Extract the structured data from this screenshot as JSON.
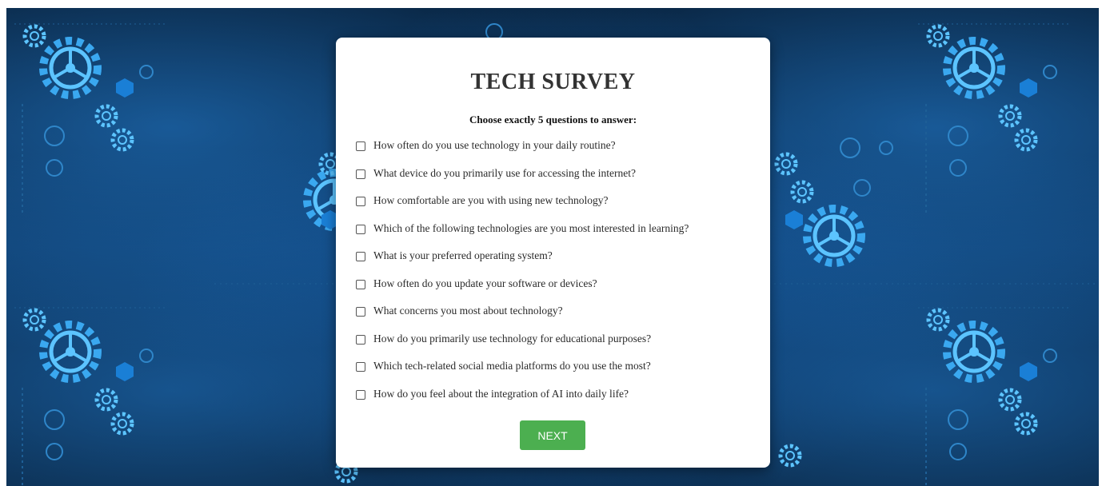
{
  "survey": {
    "title": "TECH SURVEY",
    "instruction": "Choose exactly 5 questions to answer:",
    "questions": [
      "How often do you use technology in your daily routine?",
      "What device do you primarily use for accessing the internet?",
      "How comfortable are you with using new technology?",
      "Which of the following technologies are you most interested in learning?",
      "What is your preferred operating system?",
      "How often do you update your software or devices?",
      "What concerns you most about technology?",
      "How do you primarily use technology for educational purposes?",
      "Which tech-related social media platforms do you use the most?",
      "How do you feel about the integration of AI into daily life?"
    ],
    "next_label": "NEXT"
  },
  "colors": {
    "button": "#4caf50",
    "background": "#072446",
    "gear_accent": "#3aa8f0"
  },
  "icons": {
    "background_motif": "gear-icon"
  }
}
